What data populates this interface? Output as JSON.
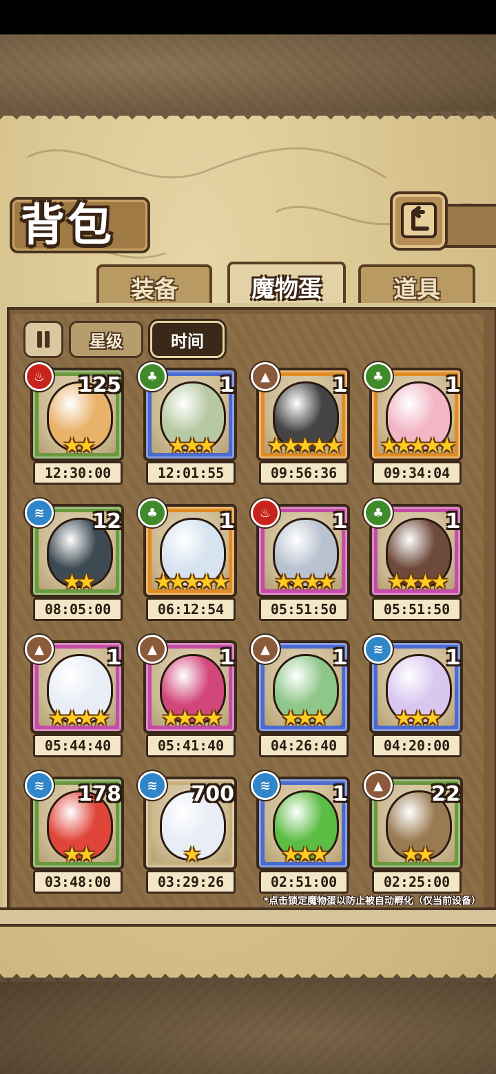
{
  "header": {
    "title": "背包"
  },
  "tabs": [
    {
      "label": "装备",
      "active": false
    },
    {
      "label": "魔物蛋",
      "active": true
    },
    {
      "label": "道具",
      "active": false
    }
  ],
  "filters": {
    "star_label": "星级",
    "time_label": "时间",
    "selected": "时间"
  },
  "eggs": [
    {
      "element": "fire",
      "count": "125",
      "stars": 2,
      "timer": "12:30:00",
      "rarity": "green",
      "color": "#e9b26a"
    },
    {
      "element": "grass",
      "count": "1",
      "stars": 3,
      "timer": "12:01:55",
      "rarity": "blue",
      "color": "#b7c9a2"
    },
    {
      "element": "earth",
      "count": "1",
      "stars": 5,
      "timer": "09:56:36",
      "rarity": "orange",
      "color": "#444444"
    },
    {
      "element": "grass",
      "count": "1",
      "stars": 5,
      "timer": "09:34:04",
      "rarity": "orange",
      "color": "#f2b6c6"
    },
    {
      "element": "water",
      "count": "12",
      "stars": 2,
      "timer": "08:05:00",
      "rarity": "green",
      "color": "#3d4a52"
    },
    {
      "element": "grass",
      "count": "1",
      "stars": 5,
      "timer": "06:12:54",
      "rarity": "orange",
      "color": "#d7e3ef"
    },
    {
      "element": "fire",
      "count": "1",
      "stars": 4,
      "timer": "05:51:50",
      "rarity": "pink",
      "color": "#b9c3d0"
    },
    {
      "element": "grass",
      "count": "1",
      "stars": 4,
      "timer": "05:51:50",
      "rarity": "pink",
      "color": "#6e4a3a"
    },
    {
      "element": "earth",
      "count": "1",
      "stars": 4,
      "timer": "05:44:40",
      "rarity": "pink",
      "color": "#e9eef6"
    },
    {
      "element": "earth",
      "count": "1",
      "stars": 4,
      "timer": "05:41:40",
      "rarity": "pink",
      "color": "#d2477a"
    },
    {
      "element": "earth",
      "count": "1",
      "stars": 3,
      "timer": "04:26:40",
      "rarity": "blue",
      "color": "#8fc78a"
    },
    {
      "element": "water",
      "count": "1",
      "stars": 3,
      "timer": "04:20:00",
      "rarity": "blue",
      "color": "#d9c7f0"
    },
    {
      "element": "water",
      "count": "178",
      "stars": 2,
      "timer": "03:48:00",
      "rarity": "green",
      "color": "#e0453a"
    },
    {
      "element": "water",
      "count": "700",
      "stars": 1,
      "timer": "03:29:26",
      "rarity": "tan",
      "color": "#e8edf6"
    },
    {
      "element": "water",
      "count": "1",
      "stars": 3,
      "timer": "02:51:00",
      "rarity": "blue",
      "color": "#5cbd45"
    },
    {
      "element": "earth",
      "count": "22",
      "stars": 2,
      "timer": "02:25:00",
      "rarity": "green",
      "color": "#9a7a52"
    }
  ],
  "footnote": "*点击锁定魔物蛋以防止被自动孵化（仅当前设备）"
}
